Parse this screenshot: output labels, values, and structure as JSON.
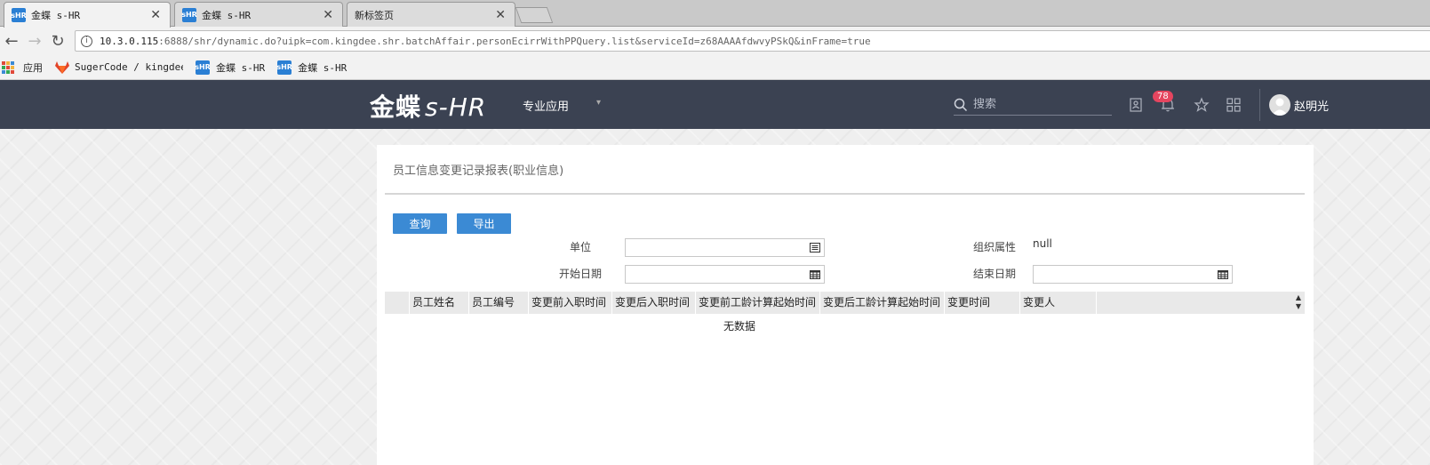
{
  "browser": {
    "tabs": [
      {
        "title": "金蝶 s-HR",
        "favicon": "sHR",
        "active": true
      },
      {
        "title": "金蝶 s-HR",
        "favicon": "sHR",
        "active": false
      },
      {
        "title": "新标签页",
        "favicon": "",
        "active": false
      }
    ],
    "url": {
      "host": "10.3.0.115",
      "rest": ":6888/shr/dynamic.do?uipk=com.kingdee.shr.batchAffair.personEcirrWithPPQuery.list&serviceId=z68AAAAfdwvyPSkQ&inFrame=true"
    },
    "bookmarks": [
      {
        "label": "应用",
        "icon": "apps-icon"
      },
      {
        "label": "SugerCode / kingdee",
        "icon": "gitlab-icon"
      },
      {
        "label": "金蝶 s-HR",
        "icon": "sHR"
      },
      {
        "label": "金蝶 s-HR",
        "icon": "sHR"
      }
    ]
  },
  "header": {
    "logo_main": "金蝶",
    "logo_sub": "s-HR",
    "menu_label": "专业应用",
    "search_placeholder": "搜索",
    "notification_count": "78",
    "username": "赵明光"
  },
  "page": {
    "title": "员工信息变更记录报表(职业信息)",
    "buttons": {
      "query": "查询",
      "export": "导出"
    },
    "filters": {
      "unit_label": "单位",
      "unit_value": "",
      "org_attr_label": "组织属性",
      "org_attr_value": "null",
      "start_date_label": "开始日期",
      "start_date_value": "",
      "end_date_label": "结束日期",
      "end_date_value": ""
    },
    "table": {
      "columns": [
        "员工姓名",
        "员工编号",
        "变更前入职时间",
        "变更后入职时间",
        "变更前工龄计算起始时间",
        "变更后工龄计算起始时间",
        "变更时间",
        "变更人"
      ],
      "empty_text": "无数据"
    }
  },
  "colors": {
    "header_bg": "#3b4252",
    "button": "#3b8ad4",
    "badge": "#e5455f"
  }
}
